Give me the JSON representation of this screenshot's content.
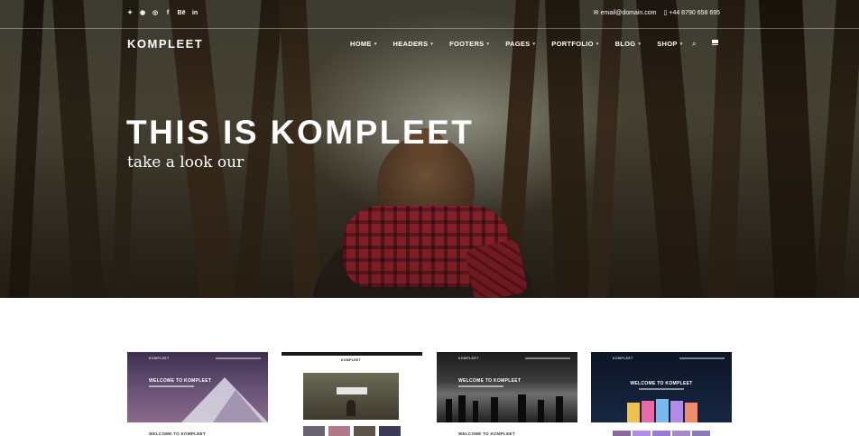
{
  "topbar": {
    "social_icons": [
      {
        "name": "twitter-icon",
        "glyph": "🐦"
      },
      {
        "name": "pinterest-icon",
        "glyph": "℗"
      },
      {
        "name": "dribbble-icon",
        "glyph": "◎"
      },
      {
        "name": "facebook-icon",
        "glyph": "f"
      },
      {
        "name": "behance-icon",
        "glyph": "Bē"
      },
      {
        "name": "linkedin-icon",
        "glyph": "in"
      }
    ],
    "email": "email@domain.com",
    "phone": "+44 8790 658 695"
  },
  "nav": {
    "logo": "KOMPLEET",
    "items": [
      {
        "label": "HOME"
      },
      {
        "label": "HEADERS"
      },
      {
        "label": "FOOTERS"
      },
      {
        "label": "PAGES"
      },
      {
        "label": "PORTFOLIO"
      },
      {
        "label": "BLOG"
      },
      {
        "label": "SHOP"
      }
    ],
    "search_icon": "search-icon",
    "menu_icon": "hamburger-icon"
  },
  "hero": {
    "title": "THIS IS KOMPLEET",
    "subtitle": "take a look our"
  },
  "thumbnails": [
    {
      "title": "WELCOME TO KOMPLEET",
      "caption": "WELCOME TO KOMPLEET",
      "logo": "KOMPLEET"
    },
    {
      "title": "INTRODUCTION",
      "caption": "",
      "logo": "KOMPLEET"
    },
    {
      "title": "WELCOME TO KOMPLEET",
      "caption": "WELCOME TO KOMPLEET",
      "logo": "KOMPLEET"
    },
    {
      "title": "WELCOME TO KOMPLEET",
      "caption": "",
      "logo": "KOMPLEET"
    }
  ],
  "colors": {
    "hero_text": "#ffffff",
    "scarf": "#9c2630",
    "thumb1": "#5a4868",
    "thumb4": "#0f1a2e"
  }
}
